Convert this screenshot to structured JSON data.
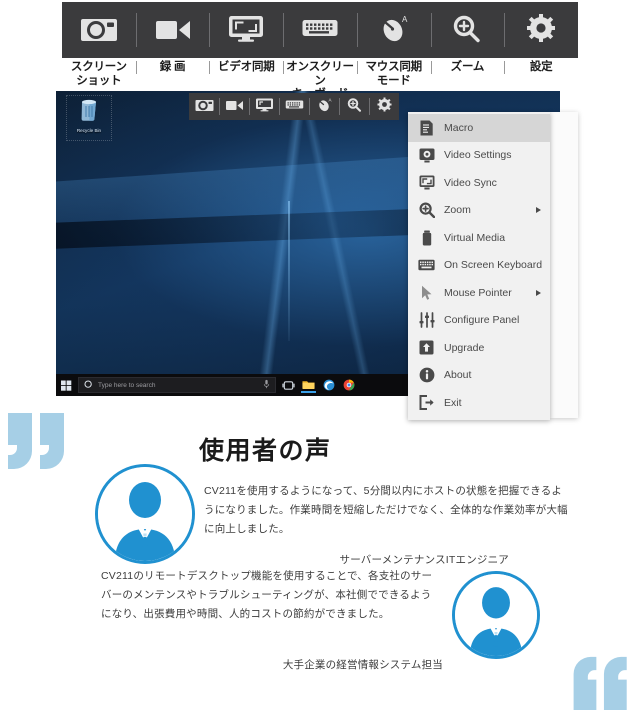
{
  "toolbar": {
    "items": [
      {
        "icon": "camera-icon",
        "label_line1": "スクリーン",
        "label_line2": "ショット"
      },
      {
        "icon": "video-camera-icon",
        "label_line1": "録 画",
        "label_line2": ""
      },
      {
        "icon": "monitor-sync-icon",
        "label_line1": "ビデオ同期",
        "label_line2": ""
      },
      {
        "icon": "keyboard-icon",
        "label_line1": "オンスクリーン",
        "label_line2": "キーボード"
      },
      {
        "icon": "mouse-sync-icon",
        "label_line1": "マウス同期",
        "label_line2": "モード"
      },
      {
        "icon": "zoom-in-icon",
        "label_line1": "ズーム",
        "label_line2": ""
      },
      {
        "icon": "gear-icon",
        "label_line1": "設定",
        "label_line2": ""
      }
    ]
  },
  "osd_toolbar": {
    "items": [
      {
        "icon": "camera-icon"
      },
      {
        "icon": "video-camera-icon"
      },
      {
        "icon": "monitor-sync-icon"
      },
      {
        "icon": "keyboard-icon"
      },
      {
        "icon": "mouse-sync-icon"
      },
      {
        "icon": "zoom-in-icon"
      },
      {
        "icon": "gear-icon"
      }
    ]
  },
  "desktop": {
    "recycle_bin_label": "Recycle Bin",
    "taskbar": {
      "start_icon": "windows-start-icon",
      "search_placeholder": "Type here to search",
      "search_icon": "search-circle-icon",
      "mic_icon": "microphone-icon",
      "pinned": [
        {
          "icon": "task-view-icon"
        },
        {
          "icon": "file-explorer-icon"
        },
        {
          "icon": "edge-browser-icon"
        },
        {
          "icon": "chrome-browser-icon"
        }
      ]
    }
  },
  "context_menu": {
    "items": [
      {
        "label": "Macro",
        "icon": "macro-icon",
        "selected": true,
        "submenu": false
      },
      {
        "label": "Video Settings",
        "icon": "video-settings-icon",
        "selected": false,
        "submenu": false
      },
      {
        "label": "Video Sync",
        "icon": "video-sync-icon",
        "selected": false,
        "submenu": false
      },
      {
        "label": "Zoom",
        "icon": "zoom-in-icon",
        "selected": false,
        "submenu": true
      },
      {
        "label": "Virtual Media",
        "icon": "virtual-media-icon",
        "selected": false,
        "submenu": false
      },
      {
        "label": "On Screen Keyboard",
        "icon": "keyboard-icon",
        "selected": false,
        "submenu": false
      },
      {
        "label": "Mouse Pointer",
        "icon": "mouse-pointer-icon",
        "selected": false,
        "submenu": true
      },
      {
        "label": "Configure Panel",
        "icon": "sliders-icon",
        "selected": false,
        "submenu": false
      },
      {
        "label": "Upgrade",
        "icon": "upgrade-icon",
        "selected": false,
        "submenu": false
      },
      {
        "label": "About",
        "icon": "info-icon",
        "selected": false,
        "submenu": false
      },
      {
        "label": "Exit",
        "icon": "exit-icon",
        "selected": false,
        "submenu": false
      }
    ]
  },
  "testimonials": {
    "section_title": "使用者の声",
    "open_quote_icon": "quote-open-icon",
    "close_quote_icon": "quote-close-icon",
    "entries": [
      {
        "avatar_icon": "user-avatar-icon",
        "body": "CV211を使用するようになって、5分間以内にホストの状態を把握できるようになりました。作業時間を短縮しただけでなく、全体的な作業効率が大幅に向上しました。",
        "attribution": "サーバーメンテナンスITエンジニア"
      },
      {
        "avatar_icon": "user-avatar-icon",
        "body": "CV211のリモートデスクトップ機能を使用することで、各支社のサーバーのメンテンスやトラブルシューティングが、本社側でできるようになり、出張費用や時間、人的コストの節約ができました。",
        "attribution": "大手企業の経営情報システム担当"
      }
    ]
  },
  "colors": {
    "toolbar_bg": "#3b3b3d",
    "menu_bg": "#f1f1f1",
    "menu_selected_bg": "#d6d6d6",
    "accent_blue": "#2091d0",
    "quote_blue": "#a6cfe6",
    "taskbar_bg": "#0b0b0d"
  }
}
